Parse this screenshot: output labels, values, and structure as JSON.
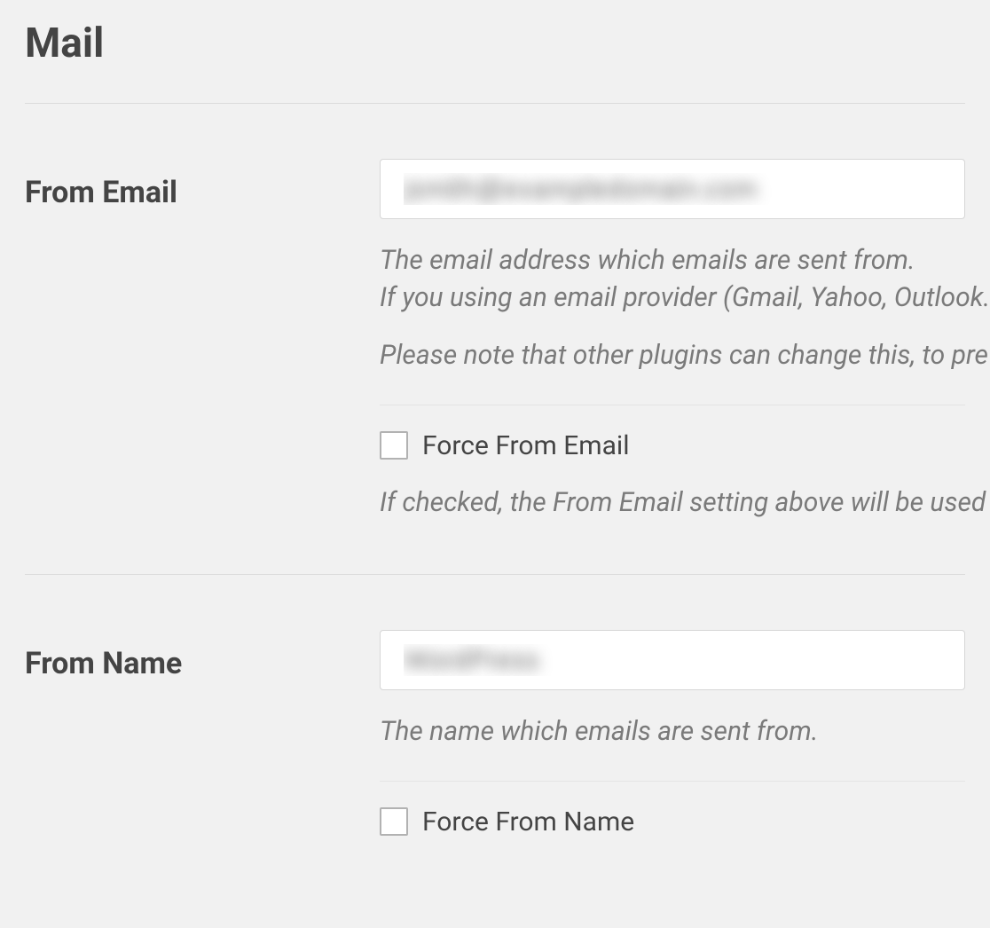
{
  "section": {
    "title": "Mail"
  },
  "from_email": {
    "label": "From Email",
    "value": "jsmith@exampledomain.com",
    "desc_line_1": "The email address which emails are sent from.",
    "desc_line_2": "If you using an email provider (Gmail, Yahoo, Outlook.",
    "desc_line_3": "Please note that other plugins can change this, to pre",
    "force_checkbox_label": "Force From Email",
    "force_desc": "If checked, the From Email setting above will be used"
  },
  "from_name": {
    "label": "From Name",
    "value": "WordPress",
    "desc": "The name which emails are sent from.",
    "force_checkbox_label": "Force From Name"
  }
}
